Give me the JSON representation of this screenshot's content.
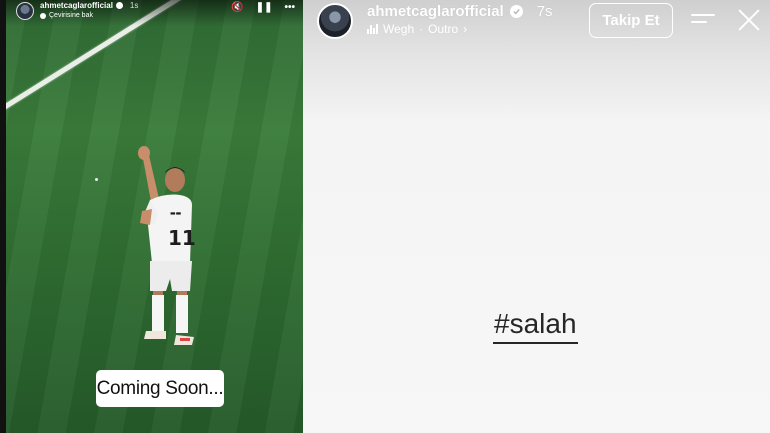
{
  "left_story": {
    "username": "ahmetcaglarofficial",
    "time": "1s",
    "translate_label": "Çevirisine bak",
    "player_shirt_number": "11",
    "sticker_text": "Coming Soon...",
    "controls": {
      "mute_icon": "🔇",
      "pause_icon": "❚❚",
      "more_icon": "•••"
    }
  },
  "right_story": {
    "username": "ahmetcaglarofficial",
    "time": "7s",
    "music": {
      "artist": "Wegh",
      "track": "Outro"
    },
    "follow_label": "Takip Et",
    "hashtag": "#salah"
  },
  "colors": {
    "pitch": "#2f6a34",
    "story_bg": "#f7f7f7",
    "hashtag_text": "#262626"
  }
}
